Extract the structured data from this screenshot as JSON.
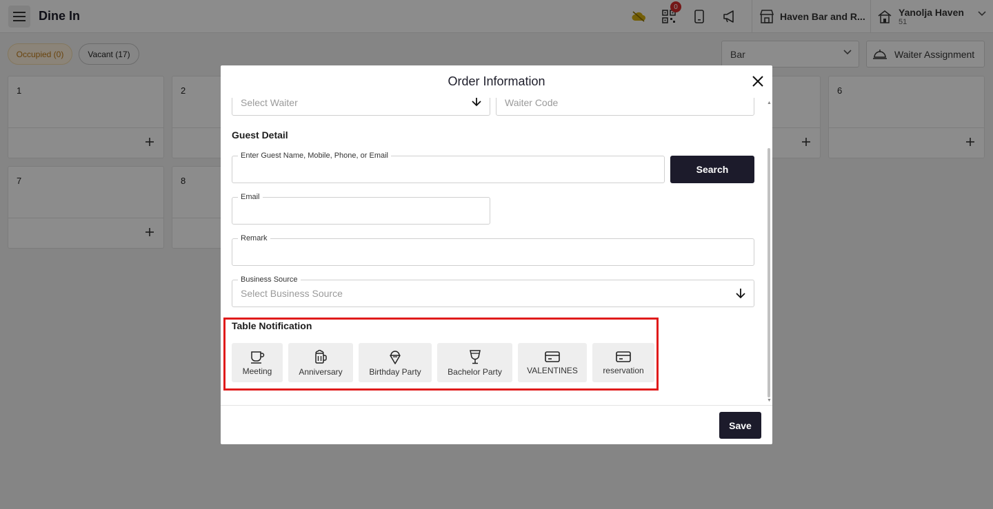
{
  "header": {
    "title": "Dine In",
    "notification_count": "0",
    "property_name": "Haven Bar and R...",
    "user_name": "Yanolja Haven",
    "user_sub": "51"
  },
  "filters": {
    "occupied": "Occupied (0)",
    "vacant": "Vacant (17)",
    "area_value": "Bar",
    "waiter_assignment": "Waiter Assignment"
  },
  "tables": [
    {
      "number": "1"
    },
    {
      "number": "2"
    },
    {
      "number": "6"
    },
    {
      "number": "7"
    },
    {
      "number": "8"
    }
  ],
  "modal": {
    "title": "Order Information",
    "waiter_placeholder": "Select Waiter",
    "waiter_code_placeholder": "Waiter Code",
    "guest_detail_label": "Guest Detail",
    "guest_search_legend": "Enter Guest Name, Mobile, Phone, or Email",
    "search_button": "Search",
    "email_legend": "Email",
    "remark_legend": "Remark",
    "business_source_legend": "Business Source",
    "business_source_placeholder": "Select Business Source",
    "table_notification_label": "Table Notification",
    "notifications": [
      {
        "label": "Meeting",
        "icon": "coffee-cup-icon"
      },
      {
        "label": "Anniversary",
        "icon": "beer-mug-icon"
      },
      {
        "label": "Birthday Party",
        "icon": "ice-cream-icon"
      },
      {
        "label": "Bachelor Party",
        "icon": "cocktail-glass-icon"
      },
      {
        "label": "VALENTINES",
        "icon": "card-icon"
      },
      {
        "label": "reservation",
        "icon": "card-icon"
      }
    ],
    "save_button": "Save"
  },
  "colors": {
    "primary_dark": "#1c1b2b",
    "highlight_red": "#e01b1b",
    "occupied_chip_text": "#c07a17",
    "badge_red": "#d42a2a"
  }
}
